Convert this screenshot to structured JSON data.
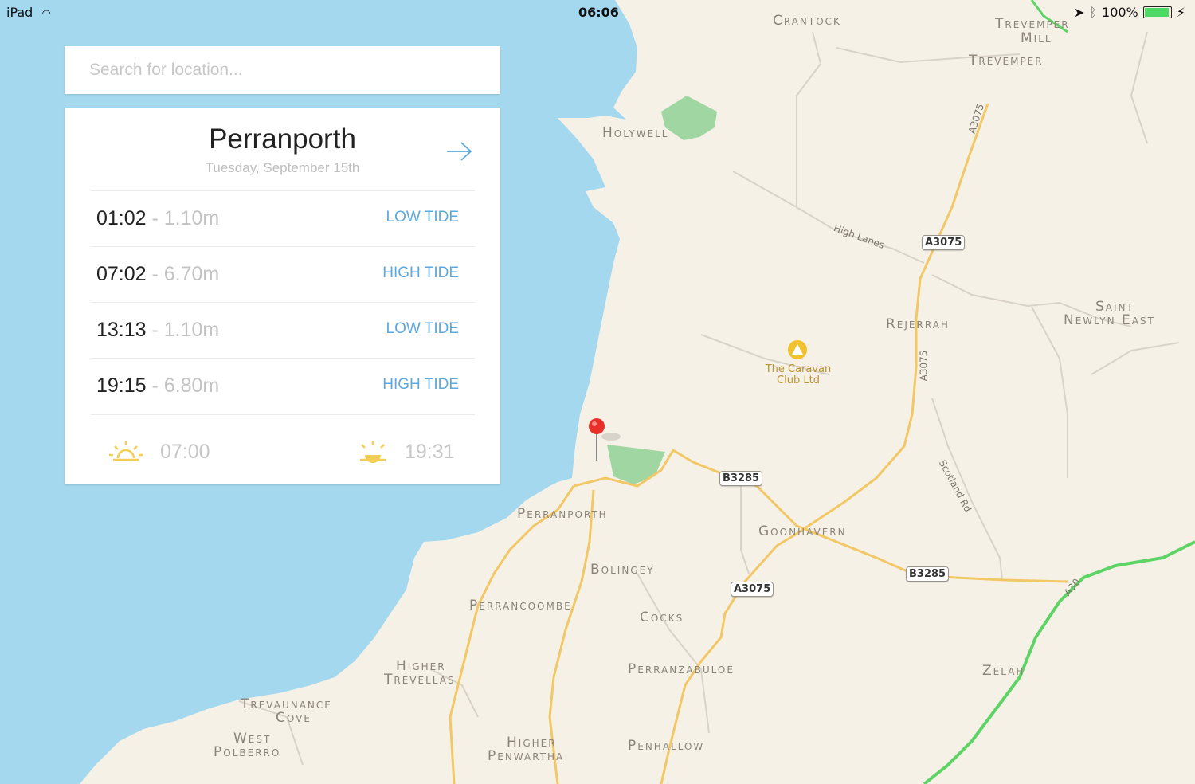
{
  "status_bar": {
    "device": "iPad",
    "time": "06:06",
    "battery": "100%",
    "battery_level": 1.0
  },
  "search": {
    "placeholder": "Search for location..."
  },
  "card": {
    "location": "Perranporth",
    "date": "Tuesday, September 15th",
    "tides": [
      {
        "time": "01:02",
        "height": " - 1.10m",
        "kind": "LOW TIDE"
      },
      {
        "time": "07:02",
        "height": " - 6.70m",
        "kind": "HIGH TIDE"
      },
      {
        "time": "13:13",
        "height": " - 1.10m",
        "kind": "LOW TIDE"
      },
      {
        "time": "19:15",
        "height": " - 6.80m",
        "kind": "HIGH TIDE"
      }
    ],
    "sunrise": "07:00",
    "sunset": "19:31"
  },
  "map": {
    "places": {
      "crantock": "Crantock",
      "trevemper_mill_1": "Trevemper",
      "trevemper_mill_2": "Mill",
      "trevemper": "Trevemper",
      "holywell": "Holywell",
      "rejerrah": "Rejerrah",
      "saint_newlyn_1": "Saint",
      "saint_newlyn_2": "Newlyn East",
      "perranporth": "Perranporth",
      "goonhavern": "Goonhavern",
      "bolingey": "Bolingey",
      "perrancoombe": "Perrancoombe",
      "cocks": "Cocks",
      "higher_trevellas_1": "Higher",
      "higher_trevellas_2": "Trevellas",
      "perranzabuloe": "Perranzabuloe",
      "zelah": "Zelah",
      "trevaunance_1": "Trevaunance",
      "trevaunance_2": "Cove",
      "west_polberro_1": "West",
      "west_polberro_2": "Polberro",
      "higher_penwartha_1": "Higher",
      "higher_penwartha_2": "Penwartha",
      "penhallow": "Penhallow"
    },
    "roads": {
      "a3075_shield_1": "A3075",
      "a3075_shield_2": "A3075",
      "b3285_shield_1": "B3285",
      "b3285_shield_2": "B3285",
      "a3075_label_1": "A3075",
      "a3075_label_2": "A3075",
      "a30_label": "A30",
      "high_lanes": "High Lanes",
      "scotland_rd": "Scotland Rd"
    },
    "poi": {
      "caravan_1": "The Caravan",
      "caravan_2": "Club Ltd"
    }
  }
}
